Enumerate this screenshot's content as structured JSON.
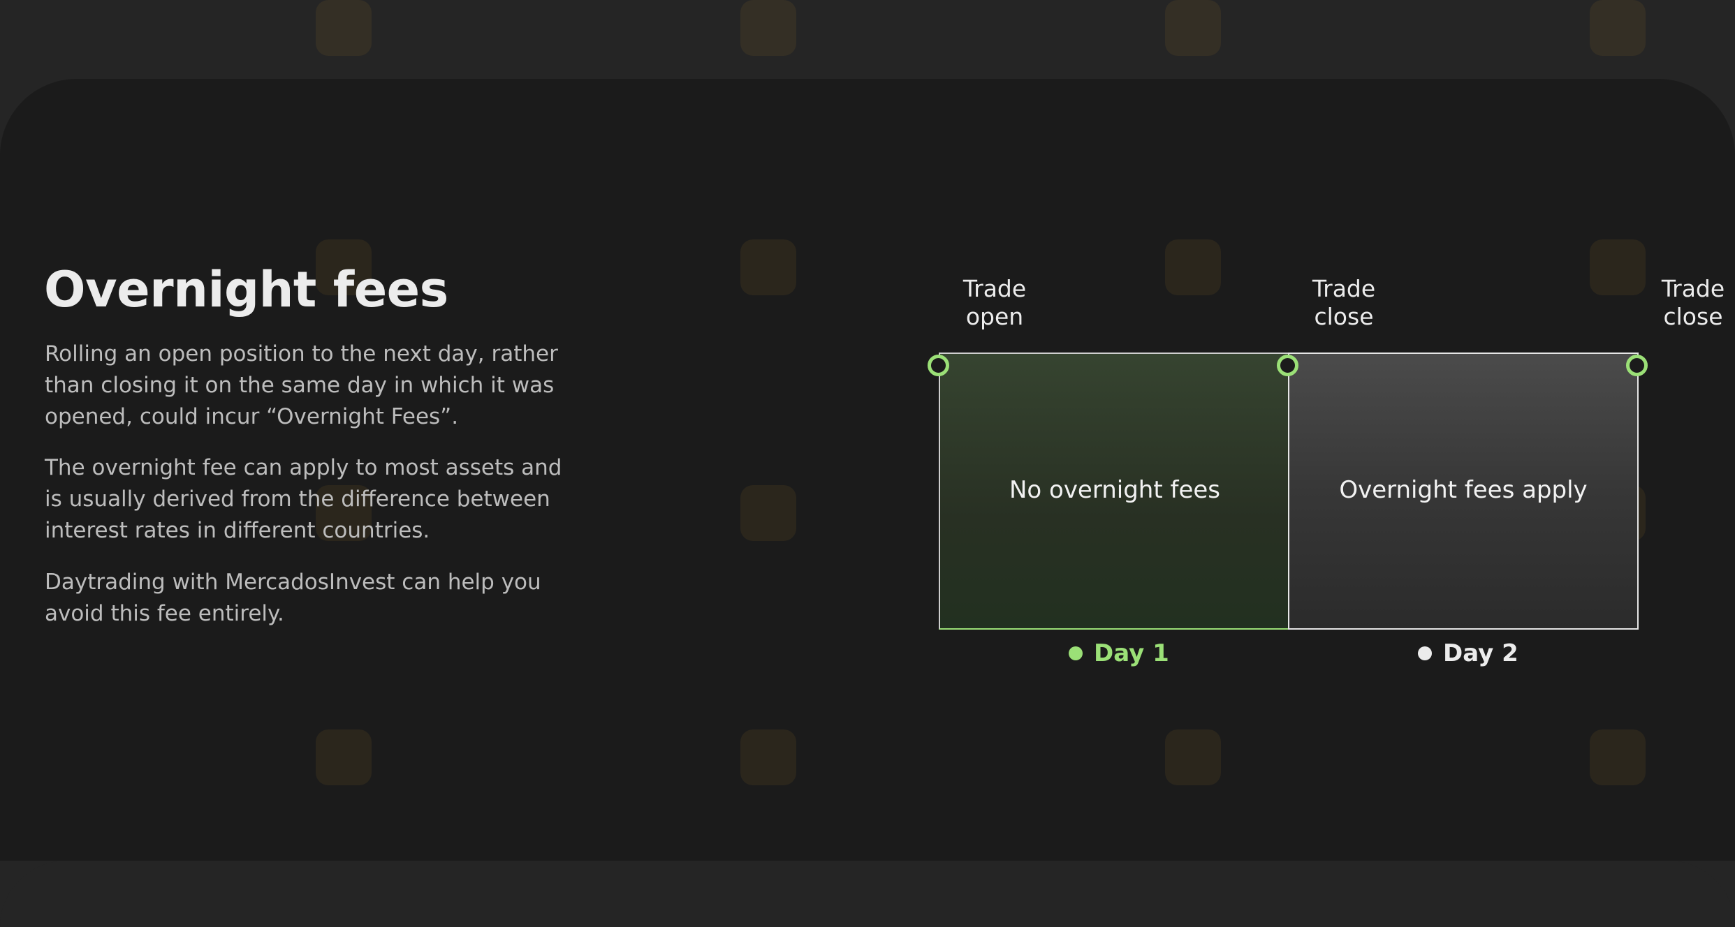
{
  "section": {
    "title": "Overnight fees",
    "paragraphs": [
      "Rolling an open position to the next day, rather than closing it on the same day in which it was opened, could incur “Overnight Fees”.",
      "The overnight fee can apply to most assets and is usually derived from the difference between interest rates in different countries.",
      "Daytrading with MercadosInvest can help you avoid this fee entirely."
    ]
  },
  "diagram": {
    "markers": [
      {
        "label_line1": "Trade",
        "label_line2": "open"
      },
      {
        "label_line1": "Trade",
        "label_line2": "close"
      },
      {
        "label_line1": "Trade",
        "label_line2": "close"
      }
    ],
    "periods": [
      {
        "label": "No overnight fees",
        "day": "Day 1",
        "color": "#9be077"
      },
      {
        "label": "Overnight fees apply",
        "day": "Day 2",
        "color": "#ececec"
      }
    ],
    "node_icon": "ring-icon",
    "accent": "#9be077"
  },
  "colors": {
    "page_bg": "#252525",
    "card_bg": "#1b1b1b",
    "text": "#ececec",
    "muted_text": "#bdbdbd"
  }
}
